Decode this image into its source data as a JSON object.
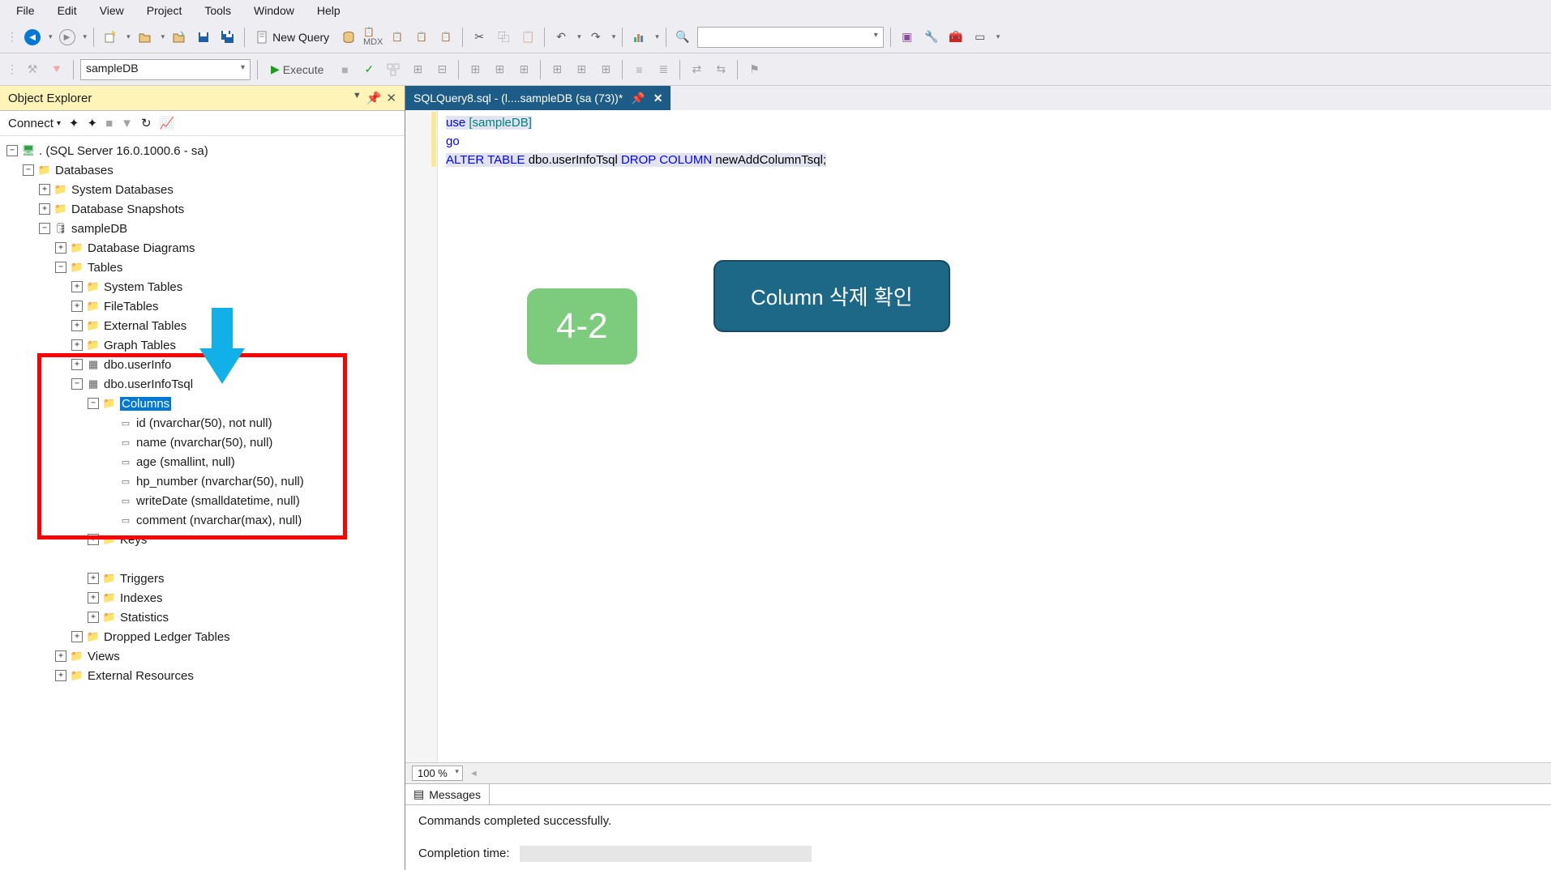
{
  "menu": {
    "file": "File",
    "edit": "Edit",
    "view": "View",
    "project": "Project",
    "tools": "Tools",
    "window": "Window",
    "help": "Help"
  },
  "toolbar": {
    "new_query": "New Query",
    "search_placeholder": ""
  },
  "toolbar2": {
    "db_name": "sampleDB",
    "execute": "Execute"
  },
  "object_explorer": {
    "title": "Object Explorer",
    "connect": "Connect",
    "tree": {
      "server": ". (SQL Server 16.0.1000.6 - sa)",
      "databases": "Databases",
      "system_databases": "System Databases",
      "database_snapshots": "Database Snapshots",
      "sampledb": "sampleDB",
      "database_diagrams": "Database Diagrams",
      "tables": "Tables",
      "system_tables": "System Tables",
      "filetables": "FileTables",
      "external_tables": "External Tables",
      "graph_tables": "Graph Tables",
      "dbo_userinfo": "dbo.userInfo",
      "dbo_userinfotsql": "dbo.userInfoTsql",
      "columns": "Columns",
      "col_id": "id (nvarchar(50), not null)",
      "col_name": "name (nvarchar(50), null)",
      "col_age": "age (smallint, null)",
      "col_hp": "hp_number (nvarchar(50), null)",
      "col_writedate": "writeDate (smalldatetime, null)",
      "col_comment": "comment (nvarchar(max), null)",
      "keys": "Keys",
      "triggers": "Triggers",
      "indexes": "Indexes",
      "statistics": "Statistics",
      "dropped_ledger": "Dropped Ledger Tables",
      "views": "Views",
      "external_resources": "External Resources"
    }
  },
  "editor": {
    "tab_title": "SQLQuery8.sql - (l....sampleDB (sa (73))*",
    "code": {
      "line1_use": "use",
      "line1_db": " [sampleDB]",
      "line2_go": "go",
      "line3_alter": "ALTER",
      "line3_table": " TABLE",
      "line3_mid": " dbo.userInfoTsql ",
      "line3_drop": "DROP",
      "line3_column": " COLUMN",
      "line3_end": " newAddColumnTsql;"
    },
    "badge_42": "4-2",
    "badge_column": "Column 삭제 확인",
    "zoom": "100 %"
  },
  "messages": {
    "tab_label": "Messages",
    "success": "Commands completed successfully.",
    "completion_label": "Completion time:"
  }
}
